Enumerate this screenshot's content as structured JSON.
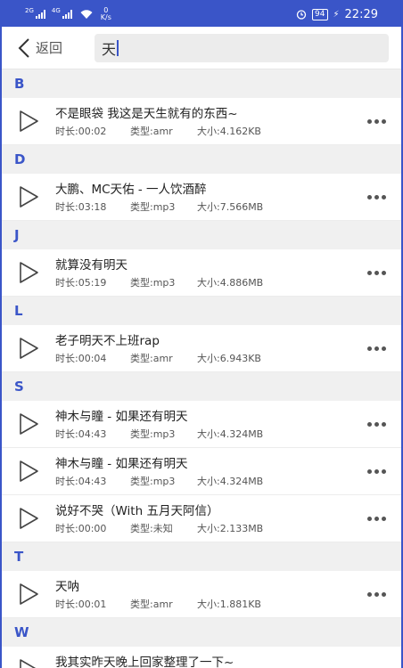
{
  "status": {
    "net1": "2G",
    "net2": "4G",
    "speed_value": "0",
    "speed_unit": "K/s",
    "battery": "94",
    "time": "22:29"
  },
  "header": {
    "back_label": "返回",
    "search_value": "天"
  },
  "labels": {
    "duration_prefix": "时长:",
    "type_prefix": "类型:",
    "size_prefix": "大小:"
  },
  "sections": [
    {
      "letter": "B",
      "items": [
        {
          "title": "不是眼袋 我这是天生就有的东西~",
          "duration": "时长:00:02",
          "type": "类型:amr",
          "size": "大小:4.162KB"
        }
      ]
    },
    {
      "letter": "D",
      "items": [
        {
          "title": "大鹏、MC天佑 - 一人饮酒醉",
          "duration": "时长:03:18",
          "type": "类型:mp3",
          "size": "大小:7.566MB"
        }
      ]
    },
    {
      "letter": "J",
      "items": [
        {
          "title": "就算没有明天",
          "duration": "时长:05:19",
          "type": "类型:mp3",
          "size": "大小:4.886MB"
        }
      ]
    },
    {
      "letter": "L",
      "items": [
        {
          "title": "老子明天不上班rap",
          "duration": "时长:00:04",
          "type": "类型:amr",
          "size": "大小:6.943KB"
        }
      ]
    },
    {
      "letter": "S",
      "items": [
        {
          "title": "神木与瞳 - 如果还有明天",
          "duration": "时长:04:43",
          "type": "类型:mp3",
          "size": "大小:4.324MB"
        },
        {
          "title": "神木与瞳 - 如果还有明天",
          "duration": "时长:04:43",
          "type": "类型:mp3",
          "size": "大小:4.324MB"
        },
        {
          "title": "说好不哭（With 五月天阿信）",
          "duration": "时长:00:00",
          "type": "类型:未知",
          "size": "大小:2.133MB"
        }
      ]
    },
    {
      "letter": "T",
      "items": [
        {
          "title": "天呐",
          "duration": "时长:00:01",
          "type": "类型:amr",
          "size": "大小:1.881KB"
        }
      ]
    },
    {
      "letter": "W",
      "items": [
        {
          "title": "我其实昨天晚上回家整理了一下~",
          "duration": "",
          "type": "",
          "size": ""
        }
      ]
    }
  ]
}
